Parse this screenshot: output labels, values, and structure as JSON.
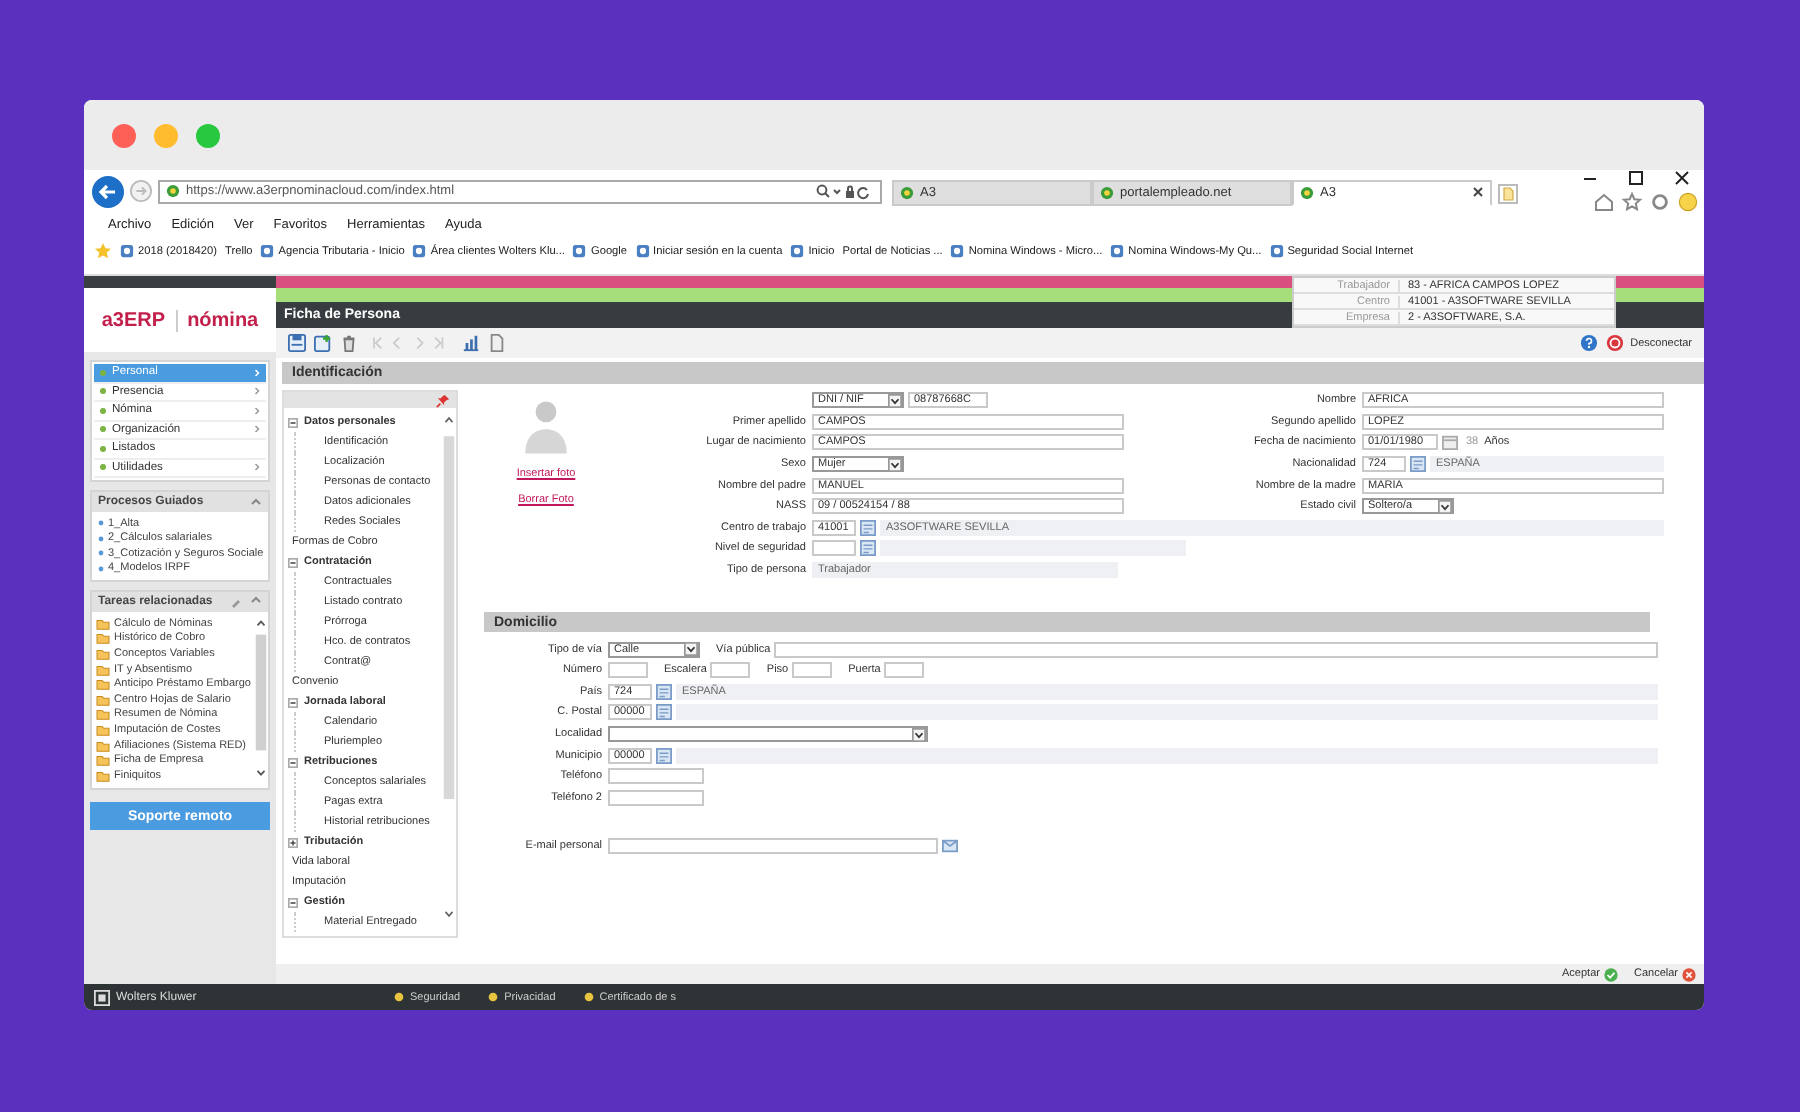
{
  "browser": {
    "url": "https://www.a3erpnominacloud.com/index.html",
    "tabs": [
      {
        "label": "A3",
        "selected": false
      },
      {
        "label": "portalempleado.net",
        "selected": false
      },
      {
        "label": "A3",
        "selected": true
      }
    ],
    "menu": [
      "Archivo",
      "Edición",
      "Ver",
      "Favoritos",
      "Herramientas",
      "Ayuda"
    ],
    "favorites": [
      {
        "label": "2018 (2018420)",
        "icon": true
      },
      {
        "label": "Trello",
        "icon": false
      },
      {
        "label": "Agencia Tributaria - Inicio",
        "icon": true
      },
      {
        "label": "Área clientes Wolters Klu...",
        "icon": true
      },
      {
        "label": "Google",
        "icon": true
      },
      {
        "label": "Iniciar sesión en la cuenta",
        "icon": true
      },
      {
        "label": "Inicio",
        "icon": true
      },
      {
        "label": "Portal de Noticias ...",
        "icon": false
      },
      {
        "label": "Nomina Windows - Micro...",
        "icon": true
      },
      {
        "label": "Nomina Windows-My Qu...",
        "icon": true
      },
      {
        "label": "Seguridad Social Internet",
        "icon": true
      }
    ]
  },
  "app": {
    "logo": {
      "brand": "a3ERP",
      "product": "nómina"
    },
    "context": [
      {
        "label": "Trabajador",
        "value": "83 - AFRICA CAMPOS LOPEZ"
      },
      {
        "label": "Centro",
        "value": "41001 - A3SOFTWARE SEVILLA"
      },
      {
        "label": "Empresa",
        "value": "2 - A3SOFTWARE, S.A."
      }
    ],
    "nav": [
      {
        "label": "Personal",
        "selected": true,
        "submenu": true
      },
      {
        "label": "Presencia",
        "selected": false,
        "submenu": true
      },
      {
        "label": "Nómina",
        "selected": false,
        "submenu": true
      },
      {
        "label": "Organización",
        "selected": false,
        "submenu": true
      },
      {
        "label": "Listados",
        "selected": false,
        "submenu": false
      },
      {
        "label": "Utilidades",
        "selected": false,
        "submenu": true
      }
    ],
    "guided": {
      "title": "Procesos Guiados",
      "items": [
        "1_Alta",
        "2_Cálculos salariales",
        "3_Cotización y Seguros Sociale",
        "4_Modelos IRPF"
      ]
    },
    "tasks": {
      "title": "Tareas relacionadas",
      "items": [
        "Cálculo de Nóminas",
        "Histórico de Cobro",
        "Conceptos Variables",
        "IT y Absentismo",
        "Anticipo Préstamo Embargo",
        "Centro Hojas de Salario",
        "Resumen de Nómina",
        "Imputación de Costes",
        "Afiliaciones (Sistema RED)",
        "Ficha de Empresa",
        "Finiquitos"
      ]
    },
    "support_button": "Soporte remoto",
    "page_title": "Ficha de Persona",
    "disconnect": "Desconectar",
    "section_title": "Identificación",
    "tree": [
      {
        "label": "Datos personales",
        "kind": "group",
        "expanded": true,
        "children": [
          "Identificación",
          "Localización",
          "Personas de contacto",
          "Datos adicionales",
          "Redes Sociales"
        ]
      },
      {
        "label": "Formas de Cobro",
        "kind": "leaf"
      },
      {
        "label": "Contratación",
        "kind": "group",
        "expanded": true,
        "children": [
          "Contractuales",
          "Listado contrato",
          "Prórroga",
          "Hco. de contratos",
          "Contrat@"
        ]
      },
      {
        "label": "Convenio",
        "kind": "leaf"
      },
      {
        "label": "Jornada laboral",
        "kind": "group",
        "expanded": true,
        "children": [
          "Calendario",
          "Pluriempleo"
        ]
      },
      {
        "label": "Retribuciones",
        "kind": "group",
        "expanded": true,
        "children": [
          "Conceptos salariales",
          "Pagas extra",
          "Historial retribuciones"
        ]
      },
      {
        "label": "Tributación",
        "kind": "group",
        "expanded": false
      },
      {
        "label": "Vida laboral",
        "kind": "leaf"
      },
      {
        "label": "Imputación",
        "kind": "leaf"
      },
      {
        "label": "Gestión",
        "kind": "group",
        "expanded": true,
        "children": [
          "Material Entregado"
        ]
      }
    ],
    "photo_links": [
      "Insertar foto",
      "Borrar Foto"
    ],
    "id_left": [
      {
        "fields": [
          {
            "kind": "doc",
            "doc_type": "DNI / NIF",
            "value": "08787668C"
          }
        ]
      },
      {
        "fields": [
          {
            "kind": "text",
            "label": "Primer apellido",
            "value": "CAMPOS"
          }
        ]
      },
      {
        "fields": [
          {
            "kind": "text",
            "label": "Lugar de nacimiento",
            "value": "CAMPOS"
          }
        ]
      },
      {
        "fields": [
          {
            "kind": "select",
            "label": "Sexo",
            "value": "Mujer"
          }
        ]
      },
      {
        "fields": [
          {
            "kind": "text",
            "label": "Nombre del padre",
            "value": "MANUEL"
          }
        ]
      },
      {
        "fields": [
          {
            "kind": "text",
            "label": "NASS",
            "value": "09 / 00524154 / 88"
          }
        ]
      }
    ],
    "id_right": [
      {
        "fields": [
          {
            "kind": "text",
            "label": "Nombre",
            "value": "AFRICA"
          }
        ]
      },
      {
        "fields": [
          {
            "kind": "text",
            "label": "Segundo apellido",
            "value": "LOPEZ"
          }
        ]
      },
      {
        "fields": [
          {
            "kind": "date",
            "label": "Fecha de nacimiento",
            "value": "01/01/1980",
            "age": "38",
            "unit": "Años"
          }
        ]
      },
      {
        "fields": [
          {
            "kind": "lookup",
            "label": "Nacionalidad",
            "code": "724",
            "description": "ESPAÑA"
          }
        ]
      },
      {
        "fields": [
          {
            "kind": "text",
            "label": "Nombre de la madre",
            "value": "MARIA"
          }
        ]
      },
      {
        "fields": [
          {
            "kind": "select",
            "label": "Estado civil",
            "value": "Soltero/a"
          }
        ]
      }
    ],
    "id_bottom": [
      {
        "fields": [
          {
            "kind": "lookup",
            "label": "Centro de trabajo",
            "code": "41001",
            "description": "A3SOFTWARE SEVILLA"
          }
        ]
      },
      {
        "fields": [
          {
            "kind": "lookup_short",
            "label": "Nivel de seguridad"
          }
        ]
      },
      {
        "fields": [
          {
            "kind": "readonly",
            "label": "Tipo de persona",
            "value": "Trabajador"
          }
        ]
      }
    ],
    "address_title": "Domicilio",
    "address_rows": [
      {
        "fields": [
          {
            "kind": "select",
            "label": "Tipo de vía",
            "value": "Calle"
          },
          {
            "kind": "text",
            "label": "Vía pública"
          }
        ]
      },
      {
        "fields": [
          {
            "kind": "short",
            "label": "Número"
          },
          {
            "kind": "short",
            "label": "Escalera"
          },
          {
            "kind": "short",
            "label": "Piso"
          },
          {
            "kind": "short",
            "label": "Puerta"
          }
        ]
      },
      {
        "fields": [
          {
            "kind": "lookup",
            "label": "País",
            "code": "724",
            "description": "ESPAÑA"
          }
        ]
      },
      {
        "fields": [
          {
            "kind": "lookup",
            "label": "C. Postal",
            "code": "00000"
          }
        ]
      },
      {
        "fields": [
          {
            "kind": "combo",
            "label": "Localidad"
          }
        ]
      },
      {
        "fields": [
          {
            "kind": "lookup",
            "label": "Municipio",
            "code": "00000"
          }
        ]
      },
      {
        "fields": [
          {
            "kind": "medium",
            "label": "Teléfono"
          }
        ]
      },
      {
        "fields": [
          {
            "kind": "medium",
            "label": "Teléfono 2"
          }
        ]
      },
      {
        "fields": [
          {
            "kind": "email",
            "label": "E-mail personal"
          }
        ]
      }
    ],
    "actions": [
      {
        "label": "Aceptar",
        "kind": "accept"
      },
      {
        "label": "Cancelar",
        "kind": "cancel"
      }
    ]
  },
  "status_bar": {
    "brand": "Wolters Kluwer",
    "items": [
      "Seguridad",
      "Privacidad",
      "Certificado de s"
    ]
  }
}
